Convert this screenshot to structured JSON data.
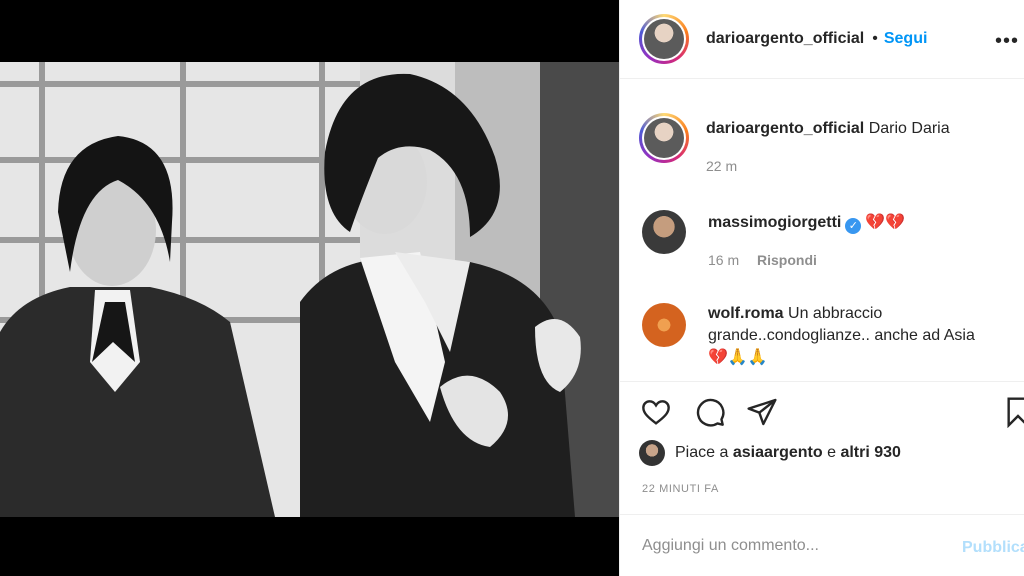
{
  "post": {
    "author": "darioargento_official",
    "separator": "•",
    "follow_label": "Segui",
    "more_icon": "more-horizontal-icon",
    "photo_description_icon": "post-photo"
  },
  "comments": [
    {
      "user": "darioargento_official",
      "text": "Dario Daria",
      "time": "22 m",
      "reply_label": ""
    },
    {
      "user": "massimogiorgetti",
      "verified": true,
      "text": "💔💔",
      "time": "16 m",
      "reply_label": "Rispondi"
    },
    {
      "user": "wolf.roma",
      "text": "Un abbraccio grande..condoglianze.. anche ad Asia 💔🙏🙏",
      "time": "",
      "reply_label": ""
    }
  ],
  "actions": {
    "like_icon": "heart-icon",
    "comment_icon": "comment-icon",
    "share_icon": "share-icon",
    "save_icon": "bookmark-icon"
  },
  "likes": {
    "prefix": "Piace a",
    "user": "asiaargento",
    "conjunction": "e",
    "others": "altri 930"
  },
  "timestamp": "22 MINUTI FA",
  "add_comment": {
    "placeholder": "Aggiungi un commento...",
    "publish_label": "Pubblica"
  },
  "colors": {
    "accent": "#0095f6",
    "publish_disabled": "#b2dffc",
    "verified": "#3897f0",
    "muted": "#8e8e8e"
  }
}
